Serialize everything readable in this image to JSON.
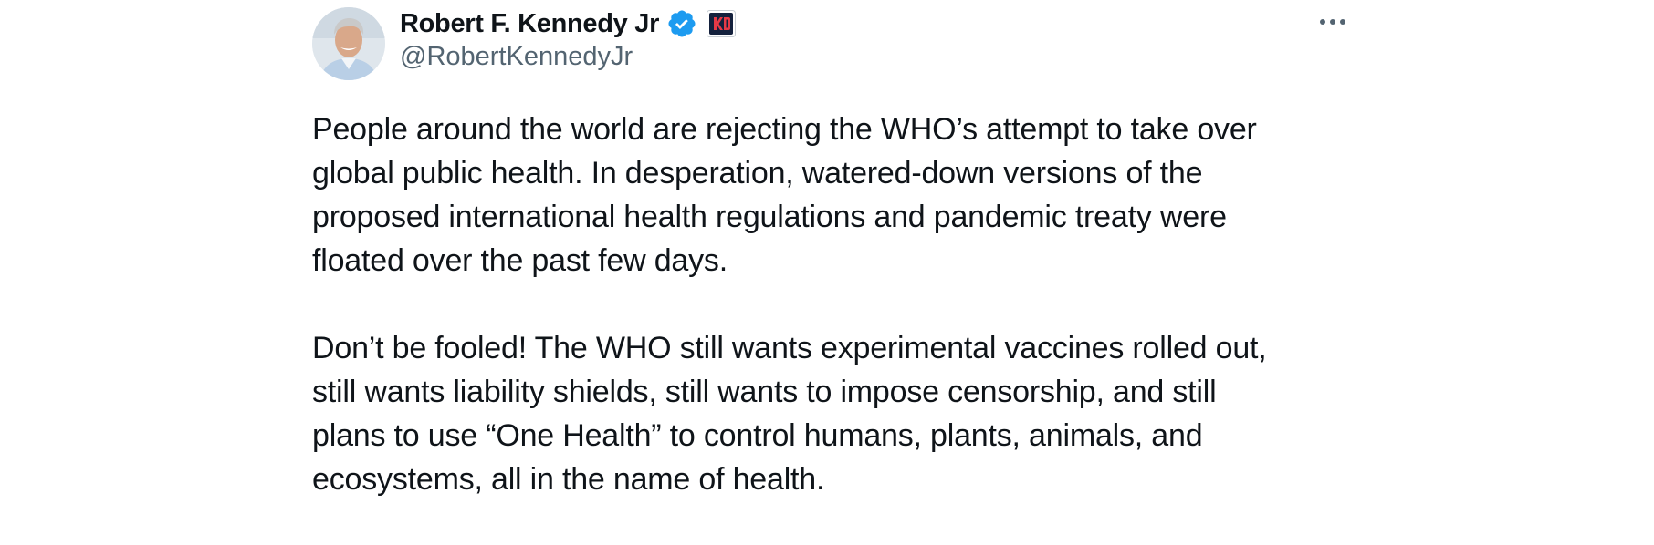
{
  "author": {
    "display_name": "Robert F. Kennedy Jr",
    "handle": "@RobertKennedyJr",
    "avatar_icon": "avatar-photo-icon",
    "verified_icon": "verified-badge-icon",
    "verified_color": "#1d9bf0",
    "affiliation_icon": "campaign-logo-icon",
    "affiliation_text": "K24"
  },
  "menu": {
    "more_icon": "more-options-icon"
  },
  "tweet": {
    "paragraphs": [
      {
        "lines": [
          "People around the world are rejecting the WHO’s attempt to take over",
          "global public health. In desperation, watered-down versions of the",
          "proposed international health regulations and pandemic treaty were",
          "floated over the past few days."
        ]
      },
      {
        "lines": [
          "Don’t be fooled! The WHO still wants experimental vaccines rolled out,",
          "still wants liability shields, still wants to impose censorship, and still",
          "plans to use “One Health” to control humans, plants, animals, and",
          "ecosystems, all in the name of health."
        ]
      }
    ]
  },
  "colors": {
    "text": "#0f1419",
    "secondary": "#536471",
    "background": "#ffffff"
  }
}
